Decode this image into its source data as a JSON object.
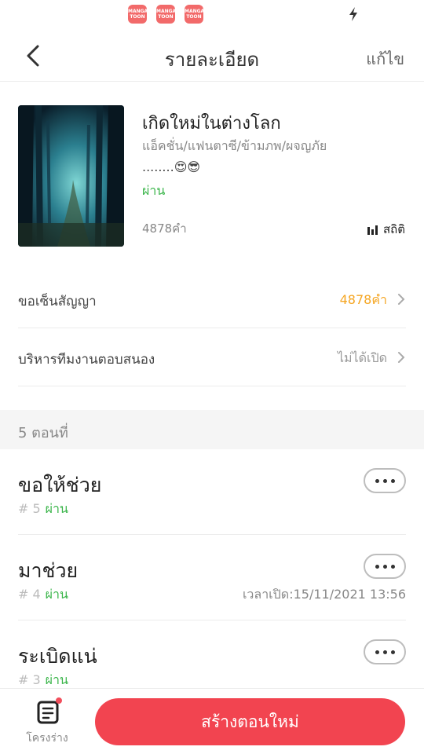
{
  "status_bar": {
    "app_icons": [
      {
        "icon": "mangatoon-app-icon",
        "text": "MANGA TOON"
      },
      {
        "icon": "mangatoon-app-icon",
        "text": "MANGA TOON"
      },
      {
        "icon": "mangatoon-app-icon",
        "text": "MANGA TOON"
      }
    ],
    "charging_icon": "lightning-bolt-icon"
  },
  "header": {
    "title": "รายละเอียด",
    "edit_label": "แก้ไข",
    "back_icon": "chevron-left-icon"
  },
  "book": {
    "title": "เกิดใหม่ในต่างโลก",
    "genres": "แอ็คชั่น/แฟนตาซี/ข้ามภพ/ผจญภัย",
    "description": "........😍😎",
    "status": "ผ่าน",
    "word_count": "4878คำ",
    "stats_label": "สถิติ"
  },
  "settings": {
    "contract": {
      "label": "ขอเซ็นสัญญา",
      "value": "4878คำ"
    },
    "team": {
      "label": "บริหารทีมงานตอบสนอง",
      "value": "ไม่ได้เปิด"
    }
  },
  "chapters_header": "5 ตอนที่",
  "chapters": [
    {
      "title": "ขอให้ช่วย",
      "number": "# 5",
      "status": "ผ่าน",
      "time": ""
    },
    {
      "title": "มาช่วย",
      "number": "# 4",
      "status": "ผ่าน",
      "time": "เวลาเปิด:15/11/2021 13:56"
    },
    {
      "title": "ระเบิดแน่",
      "number": "# 3",
      "status": "ผ่าน",
      "time": ""
    }
  ],
  "bottom": {
    "draft_label": "โครงร่าง",
    "create_label": "สร้างตอนใหม่"
  },
  "colors": {
    "accent": "#f24450",
    "status_green": "#3ab54a",
    "contract_orange": "#f5a623"
  }
}
